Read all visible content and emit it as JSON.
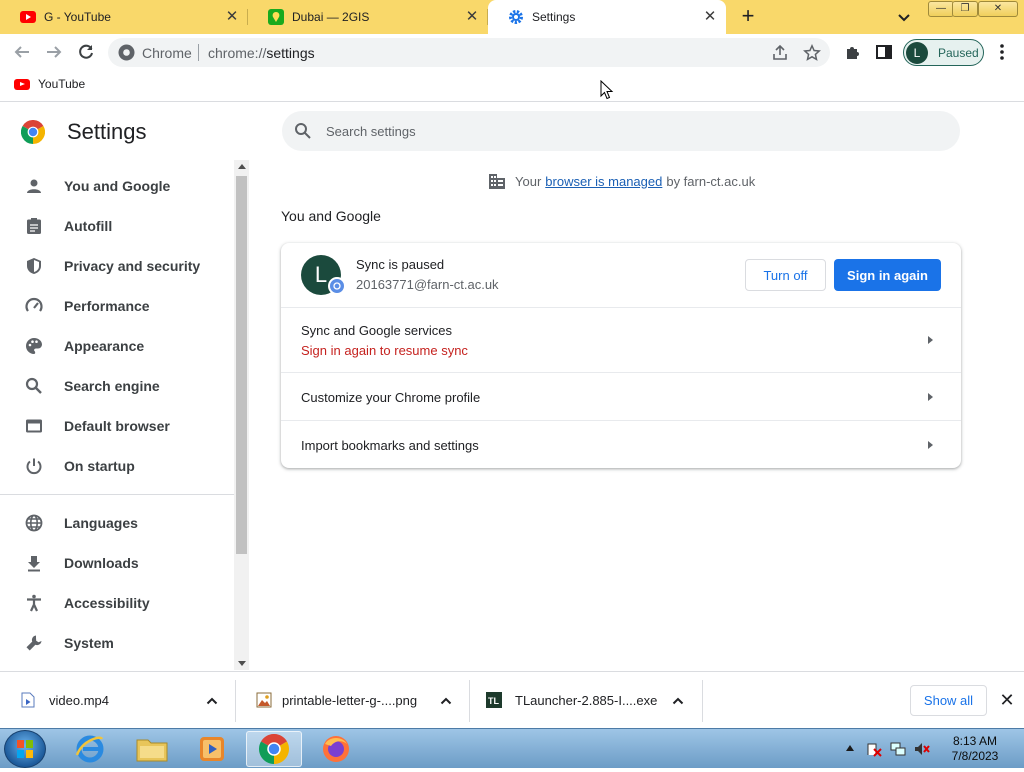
{
  "tabs": [
    {
      "title": "G - YouTube",
      "active": false
    },
    {
      "title": "Dubai — 2GIS",
      "active": false
    },
    {
      "title": "Settings",
      "active": true
    }
  ],
  "omnibox": {
    "chip": "Chrome",
    "url_scheme": "chrome://",
    "url_path": "settings"
  },
  "profile": {
    "initial": "L",
    "status": "Paused"
  },
  "bookmarks": [
    {
      "label": "YouTube"
    }
  ],
  "settings": {
    "title": "Settings",
    "search_placeholder": "Search settings",
    "nav": [
      {
        "label": "You and Google",
        "icon": "person-icon"
      },
      {
        "label": "Autofill",
        "icon": "clipboard-icon"
      },
      {
        "label": "Privacy and security",
        "icon": "shield-icon"
      },
      {
        "label": "Performance",
        "icon": "speedometer-icon"
      },
      {
        "label": "Appearance",
        "icon": "palette-icon"
      },
      {
        "label": "Search engine",
        "icon": "search-icon"
      },
      {
        "label": "Default browser",
        "icon": "browser-icon"
      },
      {
        "label": "On startup",
        "icon": "power-icon"
      },
      {
        "label": "Languages",
        "icon": "globe-icon"
      },
      {
        "label": "Downloads",
        "icon": "download-icon"
      },
      {
        "label": "Accessibility",
        "icon": "accessibility-icon"
      },
      {
        "label": "System",
        "icon": "wrench-icon"
      }
    ],
    "managed": {
      "prefix": "Your",
      "link": "browser is managed",
      "suffix": "by farn-ct.ac.uk"
    },
    "section_title": "You and Google",
    "account": {
      "initial": "L",
      "sync_status": "Sync is paused",
      "email": "20163771@farn-ct.ac.uk",
      "turn_off": "Turn off",
      "sign_in_again": "Sign in again"
    },
    "rows": [
      {
        "label": "Sync and Google services",
        "sublabel": "Sign in again to resume sync"
      },
      {
        "label": "Customize your Chrome profile"
      },
      {
        "label": "Import bookmarks and settings"
      }
    ]
  },
  "downloads": {
    "items": [
      {
        "name": "video.mp4"
      },
      {
        "name": "printable-letter-g-....png"
      },
      {
        "name": "TLauncher-2.885-I....exe"
      }
    ],
    "show_all": "Show all"
  },
  "taskbar": {
    "time": "8:13 AM",
    "date": "7/8/2023"
  },
  "colors": {
    "tabstrip": "#f9d86a",
    "accent": "#1a73e8",
    "warning": "#c5221f",
    "avatar": "#1b4a3d"
  }
}
